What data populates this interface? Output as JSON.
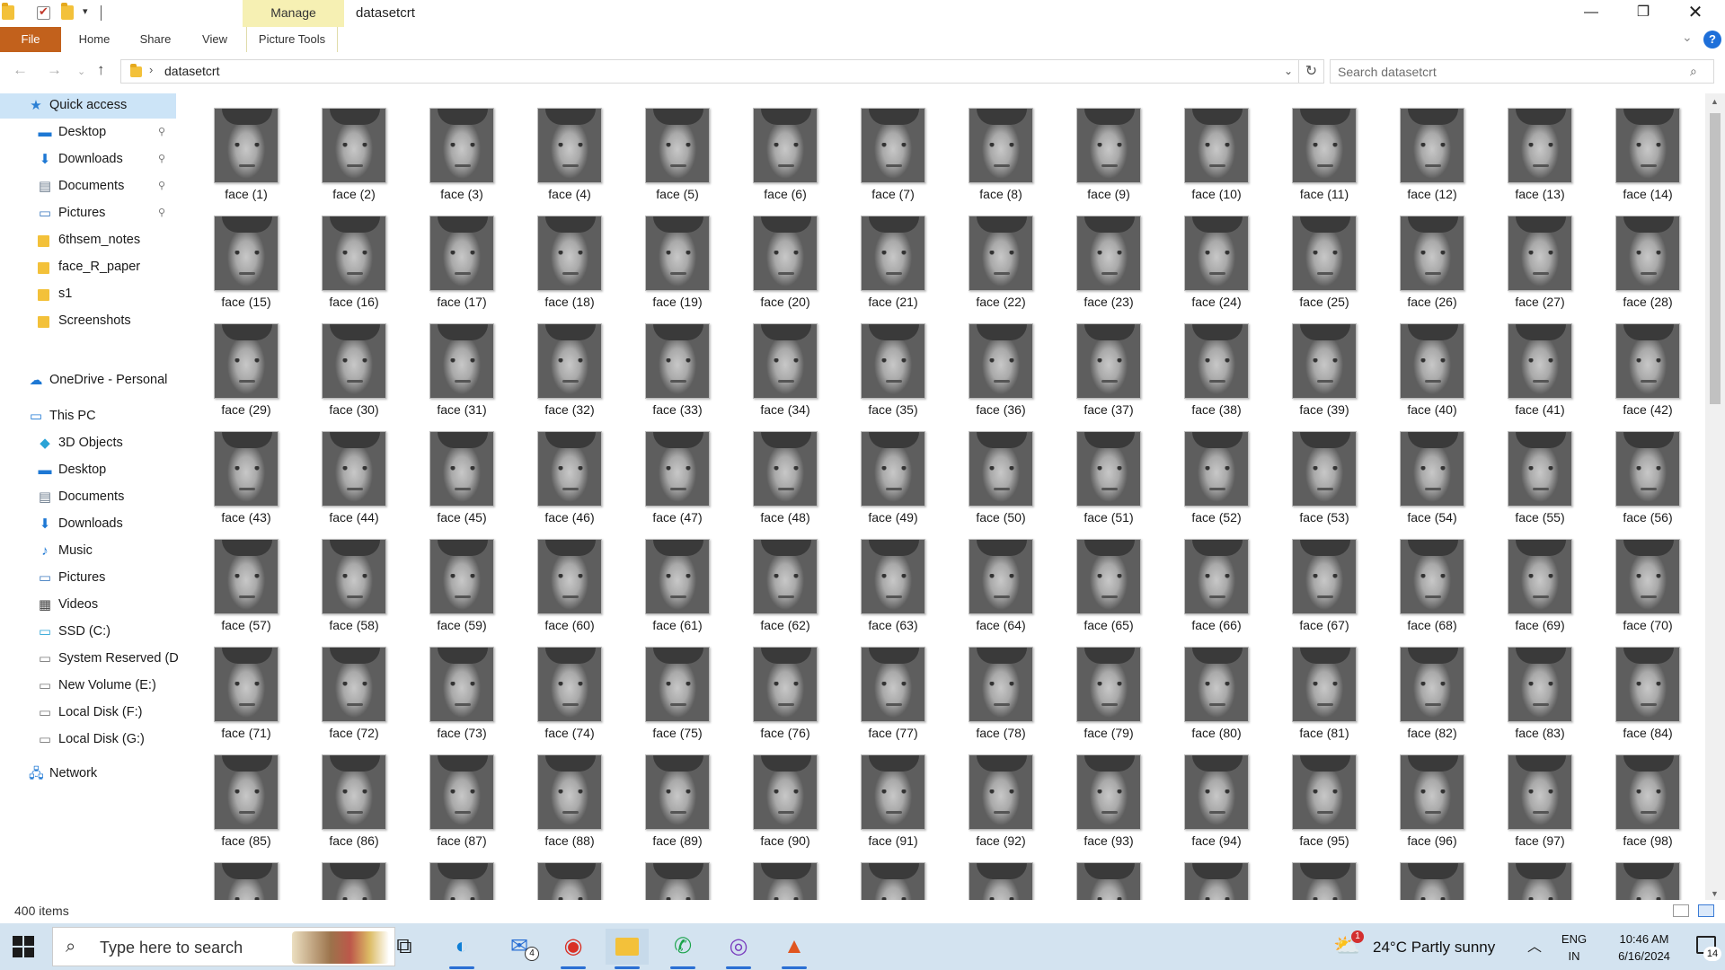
{
  "window": {
    "title": "datasetcrt",
    "manage_tab": "Manage",
    "minimize_glyph": "—",
    "maximize_glyph": "❐",
    "close_glyph": "✕"
  },
  "ribbon": {
    "tabs": [
      "File",
      "Home",
      "Share",
      "View",
      "Picture Tools"
    ],
    "help_glyph": "?",
    "expand_glyph": "⌄"
  },
  "address": {
    "path": "datasetcrt",
    "search_placeholder": "Search datasetcrt",
    "back_glyph": "←",
    "forward_glyph": "→",
    "recent_glyph": "⌄",
    "up_glyph": "↑",
    "chevron_glyph": "›",
    "dropdown_glyph": "⌄",
    "refresh_glyph": "↻",
    "search_glyph": "⌕"
  },
  "sidebar": {
    "quick_access": "Quick access",
    "quick_items": [
      {
        "label": "Desktop",
        "icon": "desktop-icon",
        "pinned": true
      },
      {
        "label": "Downloads",
        "icon": "downloads-icon",
        "pinned": true
      },
      {
        "label": "Documents",
        "icon": "documents-icon",
        "pinned": true
      },
      {
        "label": "Pictures",
        "icon": "pictures-icon",
        "pinned": true
      },
      {
        "label": "6thsem_notes",
        "icon": "folder-icon",
        "pinned": false
      },
      {
        "label": "face_R_paper",
        "icon": "folder-icon",
        "pinned": false
      },
      {
        "label": "s1",
        "icon": "folder-icon",
        "pinned": false
      },
      {
        "label": "Screenshots",
        "icon": "folder-icon",
        "pinned": false
      }
    ],
    "onedrive": "OneDrive - Personal",
    "this_pc": "This PC",
    "pc_items": [
      {
        "label": "3D Objects",
        "icon": "3d-objects-icon"
      },
      {
        "label": "Desktop",
        "icon": "desktop-icon"
      },
      {
        "label": "Documents",
        "icon": "documents-icon"
      },
      {
        "label": "Downloads",
        "icon": "downloads-icon"
      },
      {
        "label": "Music",
        "icon": "music-icon"
      },
      {
        "label": "Pictures",
        "icon": "pictures-icon"
      },
      {
        "label": "Videos",
        "icon": "videos-icon"
      },
      {
        "label": "SSD (C:)",
        "icon": "drive-c-icon"
      },
      {
        "label": "System Reserved (D",
        "icon": "drive-icon"
      },
      {
        "label": "New Volume (E:)",
        "icon": "drive-icon"
      },
      {
        "label": "Local Disk (F:)",
        "icon": "drive-icon"
      },
      {
        "label": "Local Disk (G:)",
        "icon": "drive-icon"
      }
    ],
    "network": "Network",
    "pin_glyph": "📌"
  },
  "files": {
    "name_prefix": "face",
    "labeled_count": 98,
    "partial_row_count": 14,
    "thumbnail_type": "grayscale-face-photo"
  },
  "status": {
    "item_count": "400 items"
  },
  "taskbar": {
    "search_placeholder": "Type here to search",
    "mail_badge": "4",
    "weather_temp": "24°C",
    "weather_desc": "Partly sunny",
    "weather_badge": "1",
    "lang_top": "ENG",
    "lang_bottom": "IN",
    "time": "10:46 AM",
    "date": "6/16/2024",
    "notification_count": "14",
    "apps": [
      "task-view-icon",
      "edge-icon",
      "mail-icon",
      "chrome-icon",
      "file-explorer-icon",
      "whatsapp-icon",
      "chrome-profile-icon",
      "matlab-icon"
    ]
  },
  "colors": {
    "file_tab": "#c2611c",
    "manage_tab": "#f6f0b3",
    "selection": "#cce4f7",
    "taskbar": "#d3e3f0"
  }
}
